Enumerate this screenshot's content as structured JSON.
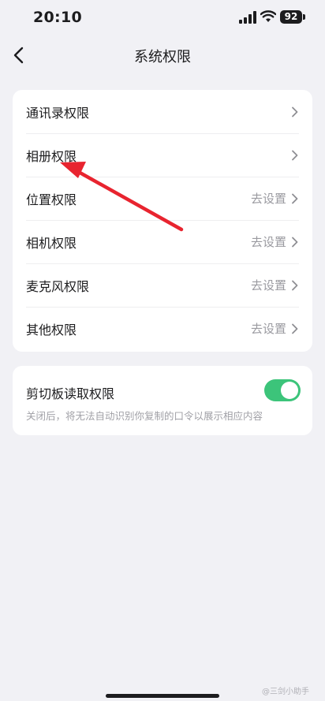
{
  "status_bar": {
    "time": "20:10",
    "battery": "92"
  },
  "header": {
    "title": "系统权限"
  },
  "permissions": [
    {
      "label": "通讯录权限",
      "hint": ""
    },
    {
      "label": "相册权限",
      "hint": ""
    },
    {
      "label": "位置权限",
      "hint": "去设置"
    },
    {
      "label": "相机权限",
      "hint": "去设置"
    },
    {
      "label": "麦克风权限",
      "hint": "去设置"
    },
    {
      "label": "其他权限",
      "hint": "去设置"
    }
  ],
  "clipboard": {
    "label": "剪切板读取权限",
    "description": "关闭后，将无法自动识别你复制的口令以展示相应内容",
    "enabled": true
  },
  "colors": {
    "toggle_on": "#3cc47a",
    "annotation_arrow": "#e8242f"
  },
  "watermark": "@三剑小助手"
}
